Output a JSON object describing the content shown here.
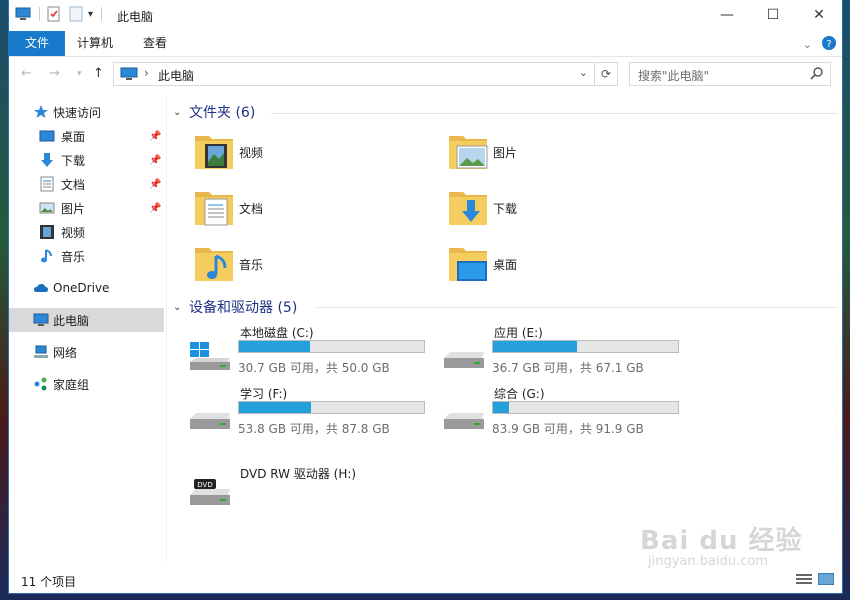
{
  "window": {
    "title": "此电脑",
    "controls": {
      "minimize": "—",
      "maximize": "☐",
      "close": "✕"
    }
  },
  "ribbon": {
    "tabs": [
      {
        "label": "文件",
        "active": true
      },
      {
        "label": "计算机",
        "active": false
      },
      {
        "label": "查看",
        "active": false
      }
    ]
  },
  "address": {
    "separator": "›",
    "path": "此电脑",
    "search_placeholder": "搜索\"此电脑\""
  },
  "nav": {
    "items": [
      {
        "label": "快速访问",
        "icon": "star-icon",
        "pinned": false
      },
      {
        "label": "桌面",
        "icon": "desktop-icon",
        "pinned": true
      },
      {
        "label": "下载",
        "icon": "download-icon",
        "pinned": true
      },
      {
        "label": "文档",
        "icon": "document-icon",
        "pinned": true
      },
      {
        "label": "图片",
        "icon": "picture-icon",
        "pinned": true
      },
      {
        "label": "视频",
        "icon": "video-icon",
        "pinned": false
      },
      {
        "label": "音乐",
        "icon": "music-icon",
        "pinned": false
      },
      {
        "label": "OneDrive",
        "icon": "cloud-icon",
        "pinned": false
      },
      {
        "label": "此电脑",
        "icon": "computer-icon",
        "pinned": false,
        "selected": true
      },
      {
        "label": "网络",
        "icon": "network-icon",
        "pinned": false
      },
      {
        "label": "家庭组",
        "icon": "homegroup-icon",
        "pinned": false
      }
    ]
  },
  "folders": {
    "header": "文件夹 (6)",
    "items": [
      {
        "label": "视频",
        "icon": "video-folder-icon"
      },
      {
        "label": "图片",
        "icon": "picture-folder-icon"
      },
      {
        "label": "文档",
        "icon": "document-folder-icon"
      },
      {
        "label": "下载",
        "icon": "download-folder-icon"
      },
      {
        "label": "音乐",
        "icon": "music-folder-icon"
      },
      {
        "label": "桌面",
        "icon": "desktop-folder-icon"
      }
    ]
  },
  "drives": {
    "header": "设备和驱动器 (5)",
    "items": [
      {
        "name": "本地磁盘 (C:)",
        "free": "30.7 GB 可用，共 50.0 GB",
        "used_fraction": 0.386,
        "icon": "windows-drive-icon"
      },
      {
        "name": "应用 (E:)",
        "free": "36.7 GB 可用，共 67.1 GB",
        "used_fraction": 0.453,
        "icon": "hard-drive-icon"
      },
      {
        "name": "学习 (F:)",
        "free": "53.8 GB 可用，共 87.8 GB",
        "used_fraction": 0.387,
        "icon": "hard-drive-icon"
      },
      {
        "name": "综合 (G:)",
        "free": "83.9 GB 可用，共 91.9 GB",
        "used_fraction": 0.087,
        "icon": "hard-drive-icon"
      },
      {
        "name": "DVD RW 驱动器 (H:)",
        "icon": "dvd-drive-icon"
      }
    ]
  },
  "status": {
    "count": "11 个项目"
  },
  "watermark": {
    "brand": "Bai du 经验",
    "url": "jingyan.baidu.com"
  },
  "colors": {
    "accent": "#1979ca",
    "bar_fill": "#26a0da",
    "header_text": "#1e3287"
  }
}
